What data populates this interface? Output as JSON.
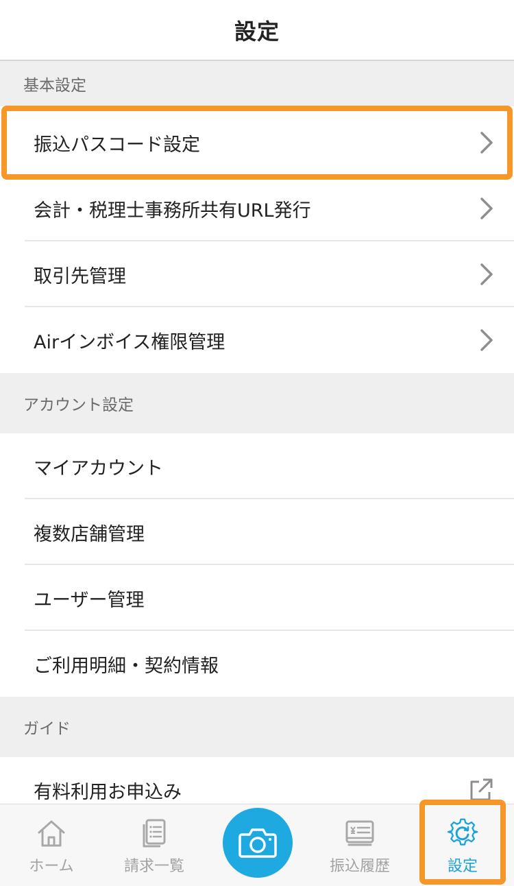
{
  "header": {
    "title": "設定"
  },
  "sections": {
    "basic": {
      "title": "基本設定",
      "items": [
        "振込パスコード設定",
        "会計・税理士事務所共有URL発行",
        "取引先管理",
        "Airインボイス権限管理"
      ]
    },
    "account": {
      "title": "アカウント設定",
      "items": [
        "マイアカウント",
        "複数店舗管理",
        "ユーザー管理",
        "ご利用明細・契約情報"
      ]
    },
    "guide": {
      "title": "ガイド",
      "items": [
        "有料利用お申込み"
      ]
    }
  },
  "tabbar": {
    "home": "ホーム",
    "invoices": "請求一覧",
    "transfers": "振込履歴",
    "settings": "設定"
  },
  "icons": {
    "chevron": "chevron-right-icon",
    "external": "external-link-icon",
    "home": "home-icon",
    "list": "document-list-icon",
    "camera": "camera-icon",
    "receipt": "receipt-icon",
    "gear": "gear-icon"
  },
  "colors": {
    "accent": "#19a3dc",
    "highlight": "#f6972a",
    "section_bg": "#efefef"
  }
}
